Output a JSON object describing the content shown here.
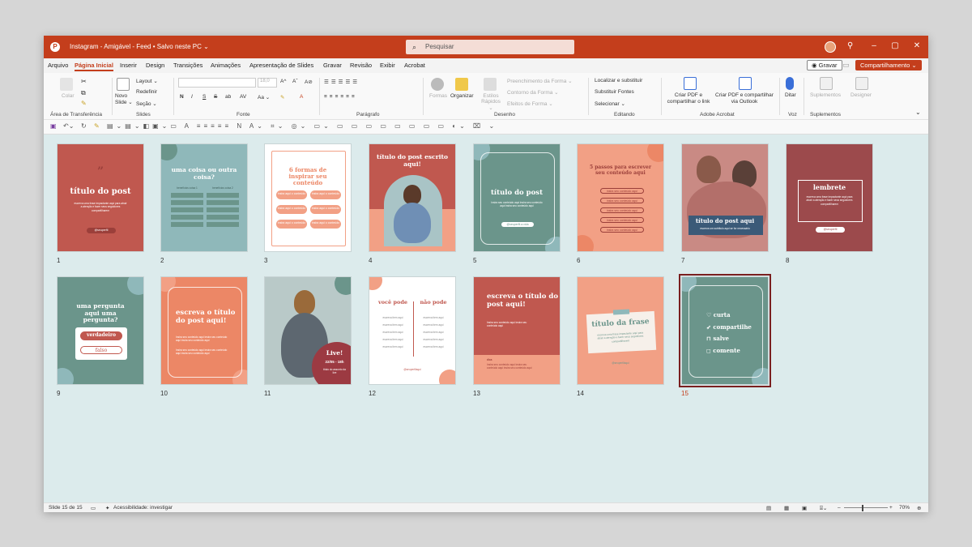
{
  "window": {
    "title": "Instagram - Amigável - Feed • Salvo neste PC ⌄",
    "search_placeholder": "Pesquisar",
    "controls": {
      "minimize": "–",
      "maximize": "▢",
      "close": "✕"
    }
  },
  "menu": {
    "tabs": [
      "Arquivo",
      "Página Inicial",
      "Inserir",
      "Design",
      "Transições",
      "Animações",
      "Apresentação de Slides",
      "Gravar",
      "Revisão",
      "Exibir",
      "Acrobat"
    ],
    "active_tab": "Página Inicial",
    "record_label": "◉ Gravar",
    "share_label": "Compartilhamento ⌄"
  },
  "ribbon": {
    "clipboard": {
      "paste": "Colar",
      "label": "Área de Transferência"
    },
    "slides": {
      "new_slide": "Novo Slide ⌄",
      "layout": "Layout ⌄",
      "reset": "Redefinir",
      "section": "Seção ⌄",
      "label": "Slides"
    },
    "font": {
      "size": "18,0",
      "label": "Fonte",
      "style_buttons": [
        "N",
        "I",
        "S",
        "S",
        "ab",
        "AV",
        "Aa ⌄"
      ]
    },
    "paragraph": {
      "label": "Parágrafo"
    },
    "drawing": {
      "shapes": "Formas",
      "arrange": "Organizar",
      "quick_styles": "Estilos Rápidos ⌄",
      "fill": "Preenchimento da Forma ⌄",
      "outline": "Contorno da Forma ⌄",
      "effects": "Efeitos de Forma ⌄",
      "label": "Desenho"
    },
    "editing": {
      "find": "Localizar e substituir",
      "replace_fonts": "Substituir Fontes",
      "select": "Selecionar ⌄",
      "label": "Editando"
    },
    "acrobat": {
      "create_share": "Criar PDF e compartilhar o link",
      "create_outlook": "Criar PDF e compartilhar via Outlook",
      "label": "Adobe Acrobat"
    },
    "voice": {
      "dictate": "Ditar",
      "label": "Voz"
    },
    "addins": {
      "addins": "Suplementos",
      "designer": "Designer",
      "label": "Suplementos"
    }
  },
  "slides": [
    {
      "num": "1",
      "title": "título do post",
      "text": "escreva uma frase impactante aqui para atrair a atenção e fazer seus seguidores compartilharem",
      "button": "@seuperfil",
      "quote": "”"
    },
    {
      "num": "2",
      "title": "uma coisa ou outra coisa?",
      "col_a": "benefícios coisa 1",
      "col_b": "benefícios coisa 2",
      "item": "item número 1"
    },
    {
      "num": "3",
      "title": "6 formas de inspirar seu conteúdo",
      "item": "insira aqui o conteúdo aqui"
    },
    {
      "num": "4",
      "title": "título do post escrito aqui!"
    },
    {
      "num": "5",
      "title": "título do post",
      "text": "Insira seu conteúdo aqui insira seu conteúdo aqui insira seu conteúdo aqui",
      "button": "@seuperfil.a.vida"
    },
    {
      "num": "6",
      "title": "5 passos para escrever seu conteúdo aqui",
      "item": "insira seu conteúdo aqui"
    },
    {
      "num": "7",
      "title": "título do post aqui",
      "text": "escreva um subtítulo aqui se for necessário"
    },
    {
      "num": "8",
      "title": "lembrete",
      "text": "escreva uma frase impactante aqui para atrair a atenção e fazer seus seguidores compartilharem",
      "button": "@seuperfil"
    },
    {
      "num": "9",
      "title": "uma pergunta aqui uma pergunta?",
      "true_label": "verdadeiro",
      "false_label": "falso"
    },
    {
      "num": "10",
      "title": "escreva o título do post aqui!",
      "text": "Insira seu conteúdo aqui insira seu conteúdo aqui insira seu conteúdo aqui"
    },
    {
      "num": "11",
      "badge_title": "Live!",
      "badge_date": "22/05 - 18h",
      "badge_text": "título do assunto da live"
    },
    {
      "num": "12",
      "col_a": "você pode",
      "col_b": "não pode",
      "item": "escreva item aqui",
      "footer": "@seuperfilaqui"
    },
    {
      "num": "13",
      "title": "escreva o título do post aqui!",
      "text": "Insira seu conteúdo aqui insira seu conteúdo aqui",
      "label": "dica",
      "footer_text": "Insira seu conteúdo aqui insira seu conteúdo aqui insira seu conteúdo aqui"
    },
    {
      "num": "14",
      "title": "título da frase",
      "text": "escreva uma frase impactante aqui para atrair a atenção e fazer seus seguidores compartilharem",
      "footer": "@seuperfilaqui"
    },
    {
      "num": "15",
      "items": [
        "curta",
        "compartilhe",
        "salve",
        "comente"
      ],
      "icons": [
        "♡",
        "➶",
        "⊓",
        "◻"
      ]
    }
  ],
  "status": {
    "slide_counter": "Slide 15 de 15",
    "accessibility": "Acessibilidade: investigar",
    "zoom": "70%"
  },
  "colors": {
    "accent": "#c43e1c",
    "rose": "#c0584f",
    "teal": "#6b958b",
    "sky": "#8fb8ba",
    "salmon": "#f2a085",
    "coral": "#ec8766",
    "wine": "#9c4a4c",
    "canvas": "#dcebec"
  }
}
